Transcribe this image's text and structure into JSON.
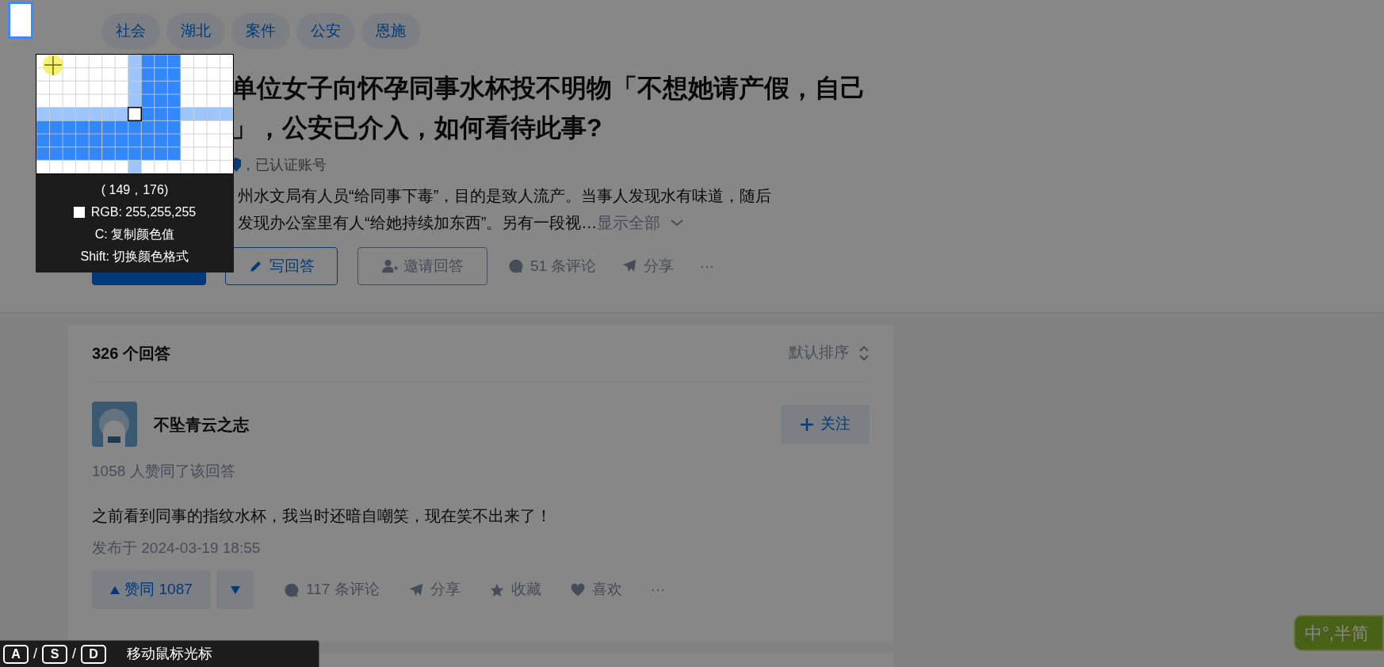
{
  "tags": [
    "社会",
    "湖北",
    "案件",
    "公安",
    "恩施"
  ],
  "question": {
    "title_lines": [
      "单位女子向怀孕同事水杯投不明物「不想她请产假，自己",
      "」，公安已介入，如何看待此事?"
    ],
    "author_meta": "，已认证账号",
    "excerpt_lines": [
      "州水文局有人员“给同事下毒”，目的是致人流产。当事人发现水有味道，随后",
      "发现办公室里有人“给她持续加东西”。另有一段视…"
    ],
    "expand_link": "显示全部",
    "write_button": "写回答",
    "invite_button": "邀请回答",
    "comments": "51 条评论",
    "share": "分享",
    "more": "···"
  },
  "answers": {
    "count_label": "326 个回答",
    "sort_label": "默认排序",
    "answer": {
      "author": "不坠青云之志",
      "follow_button": "关注",
      "upvote_summary": "1058 人赞同了该回答",
      "content": "之前看到同事的指纹水杯，我当时还暗自嘲笑，现在笑不出来了！",
      "published": "发布于 2024-03-19 18:55",
      "vote_button": "赞同 1087",
      "comments": "117 条评论",
      "share": "分享",
      "favorite": "收藏",
      "like": "喜欢",
      "more": "···"
    }
  },
  "ime_indicator": "中°,半简",
  "color_picker": {
    "coordinates": "( 149，176)",
    "rgb": "RGB: 255,255,255",
    "hints": [
      "C: 复制颜色值",
      "Shift: 切换颜色格式"
    ]
  },
  "key_hint": {
    "keys": [
      "A",
      "S",
      "D"
    ],
    "separators": [
      "/",
      "/"
    ],
    "label": "移动鼠标光标"
  }
}
